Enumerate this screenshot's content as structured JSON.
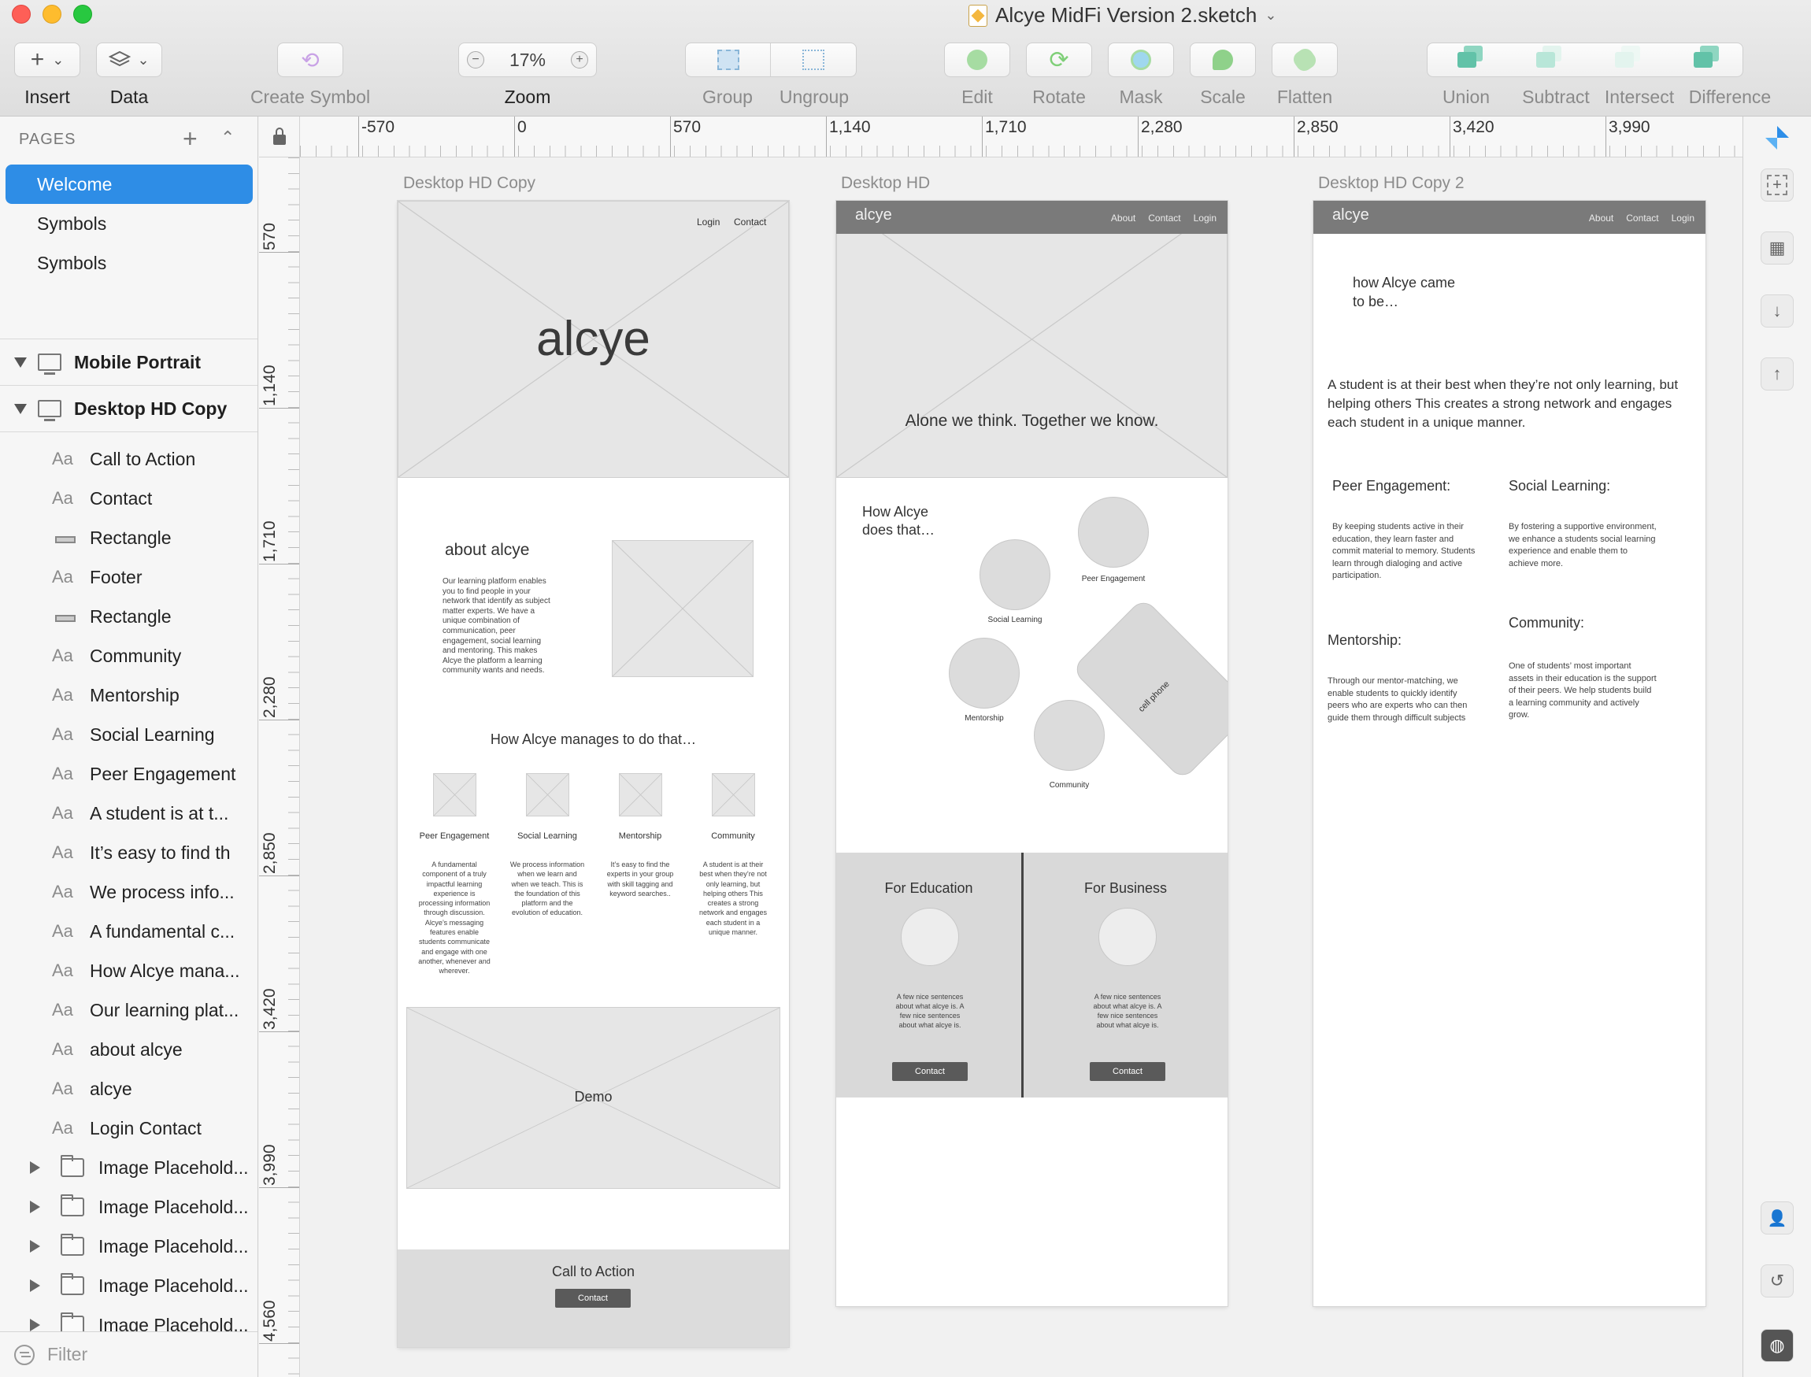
{
  "window": {
    "title": "Alcye MidFi Version 2.sketch"
  },
  "toolbar": {
    "insert": "Insert",
    "data": "Data",
    "create_symbol": "Create Symbol",
    "zoom_label": "Zoom",
    "zoom_value": "17%",
    "zoom_minus": "−",
    "zoom_plus": "+",
    "group": "Group",
    "ungroup": "Ungroup",
    "edit": "Edit",
    "rotate": "Rotate",
    "mask": "Mask",
    "scale": "Scale",
    "flatten": "Flatten",
    "union": "Union",
    "subtract": "Subtract",
    "intersect": "Intersect",
    "difference": "Difference",
    "icons": {
      "insert": "plus-icon",
      "data": "layers-icon",
      "create_symbol": "symbol-icon"
    },
    "colors": {
      "edit": "#8fd18a",
      "rotate": "#7fcf78",
      "mask": "#7fc6e8",
      "scale": "#7fcf78",
      "flatten": "#8fd18a",
      "bool": "#62c2a8"
    }
  },
  "sidebar": {
    "pages_header": "PAGES",
    "add_icon": "+",
    "collapse_icon": "⌃",
    "pages": [
      {
        "label": "Welcome",
        "active": true
      },
      {
        "label": "Symbols",
        "active": false
      },
      {
        "label": "Symbols",
        "active": false
      }
    ],
    "artboards": [
      "Mobile Portrait",
      "Desktop HD Copy"
    ],
    "layers": [
      {
        "type": "text",
        "label": "Call to Action"
      },
      {
        "type": "text",
        "label": "Contact"
      },
      {
        "type": "rect",
        "label": "Rectangle"
      },
      {
        "type": "text",
        "label": "Footer"
      },
      {
        "type": "rect",
        "label": "Rectangle"
      },
      {
        "type": "text",
        "label": "Community"
      },
      {
        "type": "text",
        "label": "Mentorship"
      },
      {
        "type": "text",
        "label": "Social Learning"
      },
      {
        "type": "text",
        "label": "Peer Engagement"
      },
      {
        "type": "text",
        "label": "A student is at t..."
      },
      {
        "type": "text",
        "label": "It’s easy to find th"
      },
      {
        "type": "text",
        "label": "We process info..."
      },
      {
        "type": "text",
        "label": "A fundamental c..."
      },
      {
        "type": "text",
        "label": "How Alcye mana..."
      },
      {
        "type": "text",
        "label": "Our learning plat..."
      },
      {
        "type": "text",
        "label": "about alcye"
      },
      {
        "type": "text",
        "label": "alcye"
      },
      {
        "type": "text",
        "label": "Login Contact"
      },
      {
        "type": "folder",
        "label": "Image Placehold..."
      },
      {
        "type": "folder",
        "label": "Image Placehold..."
      },
      {
        "type": "folder",
        "label": "Image Placehold..."
      },
      {
        "type": "folder",
        "label": "Image Placehold..."
      },
      {
        "type": "folder",
        "label": "Image Placehold..."
      }
    ],
    "text_glyph": "Aa",
    "filter_placeholder": "Filter"
  },
  "rulers": {
    "top": [
      "-570",
      "0",
      "570",
      "1,140",
      "1,710",
      "2,280",
      "2,850",
      "3,420",
      "3,990"
    ],
    "left": [
      "570",
      "1,140",
      "1,710",
      "2,280",
      "2,850",
      "3,420",
      "3,990",
      "4,560"
    ]
  },
  "canvas": {
    "ab1": {
      "title": "Desktop HD Copy",
      "nav_login": "Login",
      "nav_contact": "Contact",
      "hero_brand": "alcye",
      "about_title": "about alcye",
      "about_body": "Our learning platform enables you to find people in your network that identify as subject matter experts. We have a unique combination of communication, peer engagement, social learning and mentoring. This makes Alcye the platform a learning community wants and needs.",
      "how_title": "How Alcye manages to do that…",
      "features": [
        {
          "title": "Peer Engagement",
          "body": "A fundamental component of a truly impactful learning experience is processing information through discussion. Alcye’s messaging features enable students communicate and engage with one another, whenever and wherever."
        },
        {
          "title": "Social Learning",
          "body": "We process information when we learn and when we teach. This is the foundation of this platform and the evolution of education."
        },
        {
          "title": "Mentorship",
          "body": "It’s easy to find the experts in your group with skill tagging and keyword searches.."
        },
        {
          "title": "Community",
          "body": "A student is at their best when they’re not only learning, but helping others This creates a strong network and engages each student in a unique manner."
        }
      ],
      "demo": "Demo",
      "cta_title": "Call to Action",
      "cta_button": "Contact"
    },
    "ab2": {
      "title": "Desktop HD",
      "brand": "alcye",
      "nav": [
        "About",
        "Contact",
        "Login"
      ],
      "hero_tagline": "Alone we think. Together we know.",
      "how_title": "How Alcye does that…",
      "circle_labels": [
        "Peer Engagement",
        "Social Learning",
        "Mentorship",
        "Community"
      ],
      "phone_label": "cell phone",
      "edu_title": "For Education",
      "biz_title": "For Business",
      "blurb": "A few nice sentences about what alcye is. A few nice sentences about what alcye is.",
      "contact": "Contact"
    },
    "ab3": {
      "title": "Desktop HD Copy 2",
      "brand": "alcye",
      "nav": [
        "About",
        "Contact",
        "Login"
      ],
      "story_title": "how Alcye came to be…",
      "intro": "A student is at their best when they’re not only learning, but helping others This creates a strong network and engages each student in a unique manner.",
      "peer_title": "Peer Engagement:",
      "peer_body": "By keeping students active in their education, they learn faster and commit material to memory. Students learn through dialoging and active participation.",
      "social_title": "Social Learning:",
      "social_body": "By fostering a supportive environment, we enhance a students social learning experience and enable them to achieve more.",
      "mentor_title": "Mentorship:",
      "mentor_body": "Through our mentor-matching, we enable students to quickly identify peers who are experts who can then guide them through difficult subjects",
      "community_title": "Community:",
      "community_body": "One of students’ most important assets in their education is the support of their peers. We help students build a learning community and actively grow."
    }
  },
  "inspector": {
    "icons": [
      "pointer-icon",
      "add-frame-icon",
      "grid-icon",
      "arrow-down-icon",
      "arrow-up-icon",
      "add-user-icon",
      "history-icon",
      "globe-icon"
    ]
  }
}
